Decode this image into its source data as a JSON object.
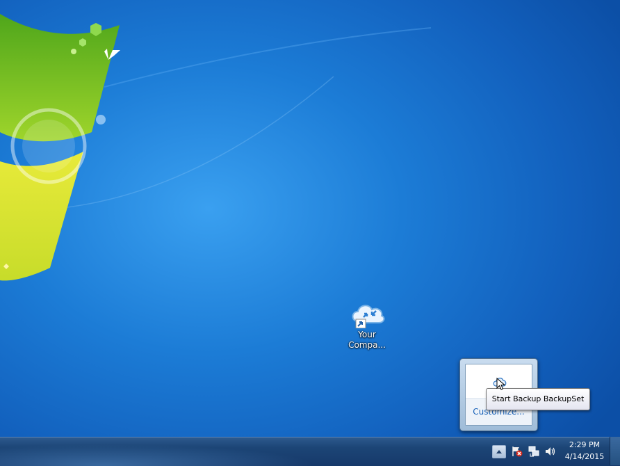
{
  "desktop": {
    "icons": [
      {
        "label_line1": "Your",
        "label_line2": "Compa...",
        "icon": "cloud-backup-shortcut-icon"
      }
    ]
  },
  "tray_flyout": {
    "link_label": "Customize...",
    "icon": "backup-tray-icon"
  },
  "tooltip": {
    "text": "Start Backup BackupSet"
  },
  "taskbar": {
    "clock": {
      "time": "2:29 PM",
      "date": "4/14/2015"
    },
    "tray_icons": [
      "show-hidden-icons-icon",
      "action-center-flag-icon",
      "network-icon",
      "volume-icon"
    ]
  },
  "colors": {
    "desktop_blue": "#1c7cd6",
    "taskbar": "#1c4576",
    "link": "#1a63b8"
  }
}
